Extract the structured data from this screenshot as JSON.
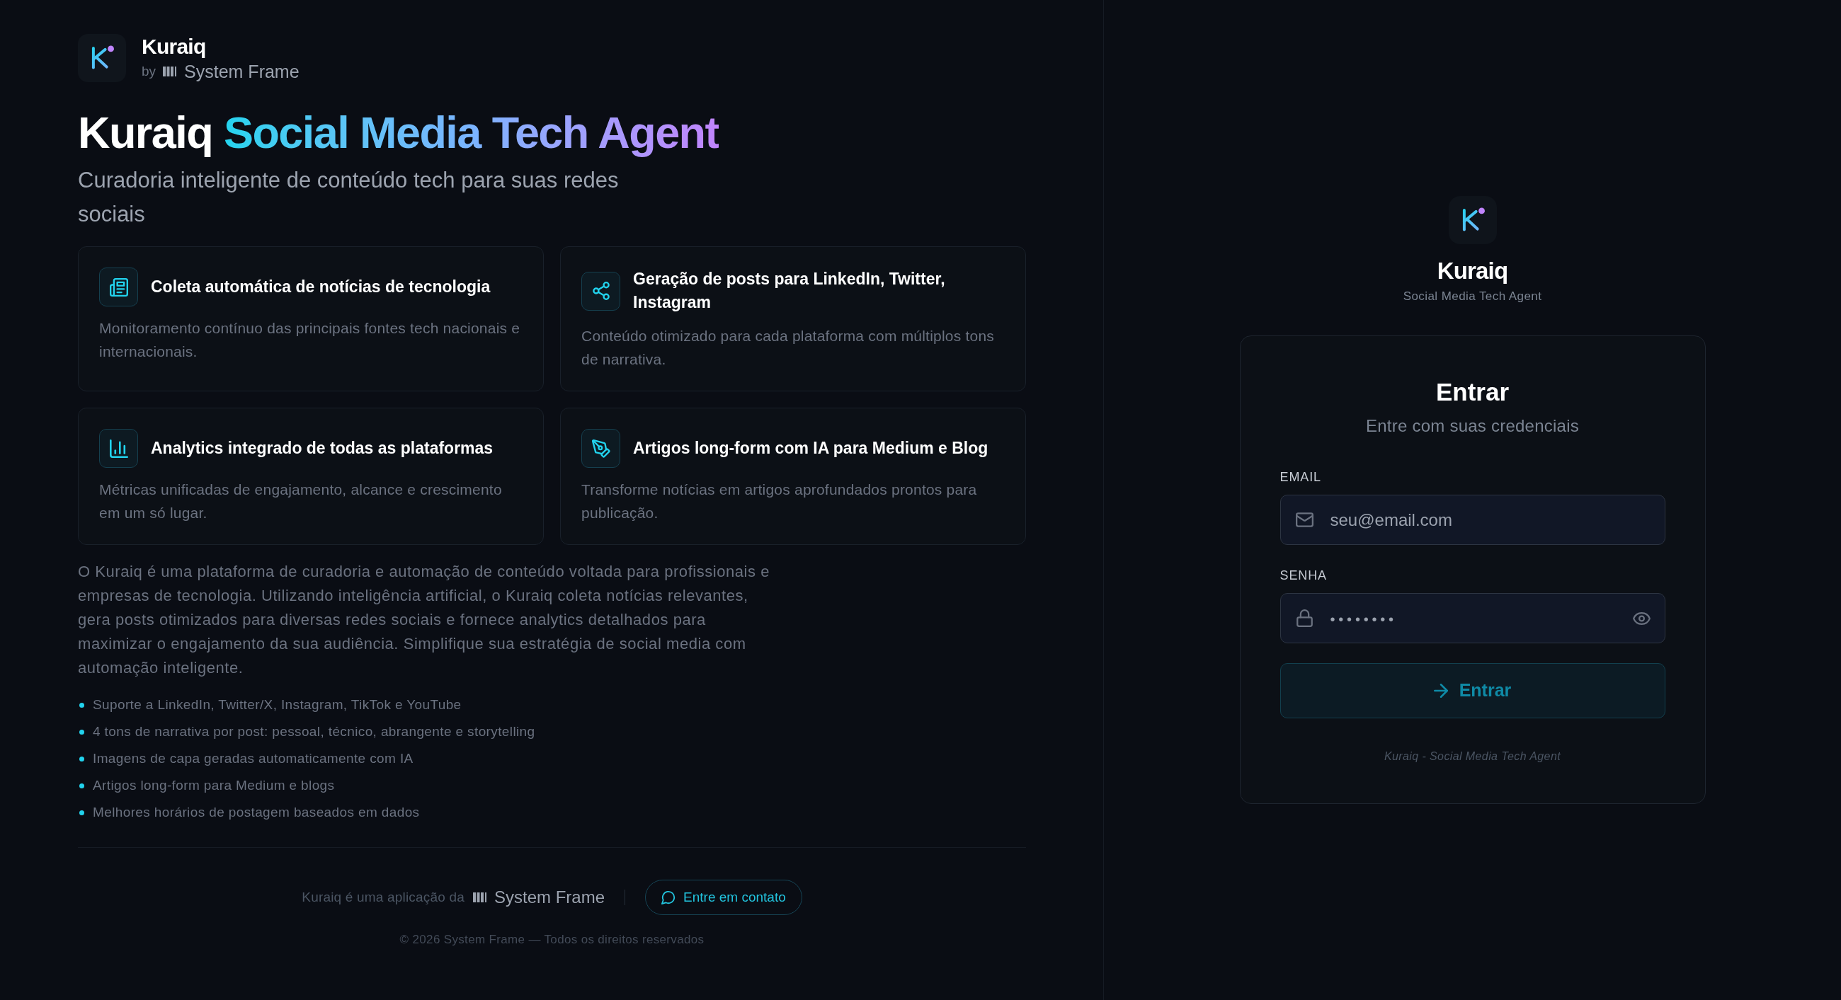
{
  "brand": {
    "name": "Kuraiq",
    "by_label": "by",
    "company": "System Frame"
  },
  "hero": {
    "title_lead": "Kuraiq",
    "title_highlight": "Social Media Tech Agent",
    "subtitle": "Curadoria inteligente de conteúdo tech para suas redes sociais"
  },
  "features": [
    {
      "title": "Coleta automática de notícias de tecnologia",
      "description": "Monitoramento contínuo das principais fontes tech nacionais e internacionais."
    },
    {
      "title": "Geração de posts para LinkedIn, Twitter, Instagram",
      "description": "Conteúdo otimizado para cada plataforma com múltiplos tons de narrativa."
    },
    {
      "title": "Analytics integrado de todas as plataformas",
      "description": "Métricas unificadas de engajamento, alcance e crescimento em um só lugar."
    },
    {
      "title": "Artigos long-form com IA para Medium e Blog",
      "description": "Transforme notícias em artigos aprofundados prontos para publicação."
    }
  ],
  "about": {
    "paragraph": "O Kuraiq é uma plataforma de curadoria e automação de conteúdo voltada para profissionais e empresas de tecnologia. Utilizando inteligência artificial, o Kuraiq coleta notícias relevantes, gera posts otimizados para diversas redes sociais e fornece analytics detalhados para maximizar o engajamento da sua audiência. Simplifique sua estratégia de social media com automação inteligente.",
    "highlights": [
      "Suporte a LinkedIn, Twitter/X, Instagram, TikTok e YouTube",
      "4 tons de narrativa por post: pessoal, técnico, abrangente e storytelling",
      "Imagens de capa geradas automaticamente com IA",
      "Artigos long-form para Medium e blogs",
      "Melhores horários de postagem baseados em dados"
    ]
  },
  "footer": {
    "made_by_label": "Kuraiq é uma aplicação da",
    "company": "System Frame",
    "contact_button": "Entre em contato",
    "copyright": "© 2026 System Frame — Todos os direitos reservados"
  },
  "login": {
    "app_name": "Kuraiq",
    "tagline": "Social Media Tech Agent",
    "title": "Entrar",
    "subtitle": "Entre com suas credenciais",
    "fields": [
      {
        "kind": "email",
        "label": "EMAIL",
        "placeholder": "seu@email.com"
      },
      {
        "kind": "password",
        "label": "SENHA",
        "placeholder": "••••••••"
      }
    ],
    "submit": "Entrar",
    "footnote": "Kuraiq - Social Media Tech Agent"
  }
}
